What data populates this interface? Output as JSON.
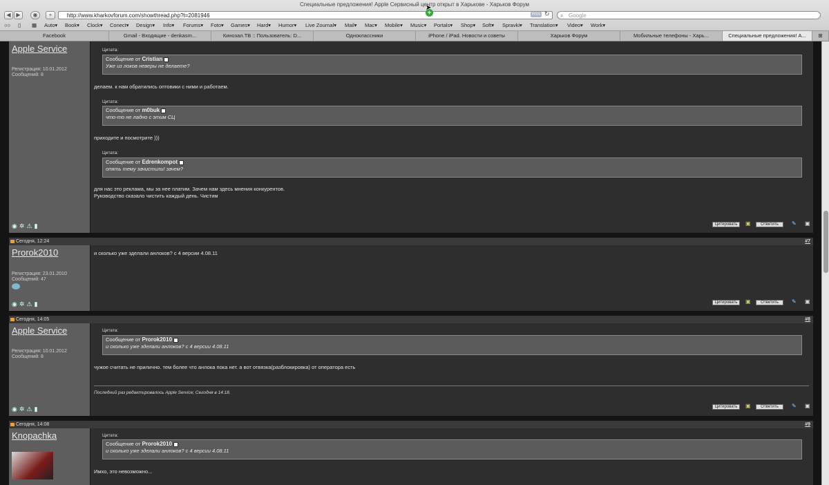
{
  "browser": {
    "title": "Специальные предложения! Apple Сервисный центр открыт в Харькове - Харьков Форум",
    "url": "http://www.kharkovforum.com/showthread.php?t=2081946",
    "search_placeholder": "Google",
    "rss": "RSS",
    "bookmarks": [
      "Auto▾",
      "Book▾",
      "Clock▾",
      "Conect▾",
      "Design▾",
      "Info▾",
      "Forums▾",
      "Foto▾",
      "Games▾",
      "Hard▾",
      "Humor▾",
      "Live Zournal▾",
      "Mail▾",
      "Mac▾",
      "Mobile▾",
      "Music▾",
      "Portals▾",
      "Shop▾",
      "Soft▾",
      "Spravki▾",
      "Translation▾",
      "Video▾",
      "Work▾"
    ],
    "tabs": [
      "Facebook",
      "Gmail - Входящие - denkasm...",
      "Кинозал.ТВ :: Пользователь: D...",
      "Одноклассники",
      "iPhone / iPad. Новости и советы",
      "Харьков Форум",
      "Мобильные телефоны - Харь...",
      "Специальные предложения! А..."
    ]
  },
  "posts": [
    {
      "user": "Apple Service",
      "reg": "Регистрация: 10.01.2012",
      "msgs": "Сообщений: 8",
      "quotes": [
        {
          "label": "Цитата:",
          "from": "Сообщение от",
          "author": "Cristian",
          "text": "Уже из локов неверы не делаете?"
        },
        {
          "label": "Цитата:",
          "from": "Сообщение от",
          "author": "m0buk",
          "text": "что-то не ладно с этим СЦ"
        },
        {
          "label": "Цитата:",
          "from": "Сообщение от",
          "author": "Edrenkompot",
          "text": "опять тему зачистили! зачем?"
        }
      ],
      "texts": [
        "делаем. к нам обратились оптовики с ними и работаем.",
        "приходите и посмотрите )))",
        "для нас это реклама, мы за нее платим. Зачем нам здесь мнения конкурентов.",
        "Руководство сказало чистить каждый день. Чистим"
      ]
    },
    {
      "date": "Сегодня, 12:24",
      "num": "#7",
      "user": "Prorok2010",
      "reg": "Регистрация: 23.01.2010",
      "msgs": "Сообщений: 47",
      "texts": [
        "и сколько уже зделали анлоков? с 4 версии 4.08.11"
      ]
    },
    {
      "date": "Сегодня, 14:05",
      "num": "#8",
      "user": "Apple Service",
      "reg": "Регистрация: 10.01.2012",
      "msgs": "Сообщений: 8",
      "quotes": [
        {
          "label": "Цитата:",
          "from": "Сообщение от",
          "author": "Prorok2010",
          "text": "и сколько уже зделали анлоков? с 4 версии 4.08.11"
        }
      ],
      "texts": [
        "чужое считать не прилично. тем более что анлока пока нет. а вот отвязка(разблокировка) от оператора есть"
      ],
      "edit": "Последний раз редактировалось Apple Service; Сегодня в 14:18."
    },
    {
      "date": "Сегодня, 14:08",
      "num": "#9",
      "user": "Knopachka",
      "quotes": [
        {
          "label": "Цитата:",
          "from": "Сообщение от",
          "author": "Prorok2010",
          "text": "и сколько уже зделали анлоков? с 4 версии 4.08.11"
        }
      ],
      "texts": [
        "Имхо, это невозможно..."
      ]
    }
  ],
  "buttons": {
    "quote": "Цитировать",
    "reply": "Ответить"
  }
}
